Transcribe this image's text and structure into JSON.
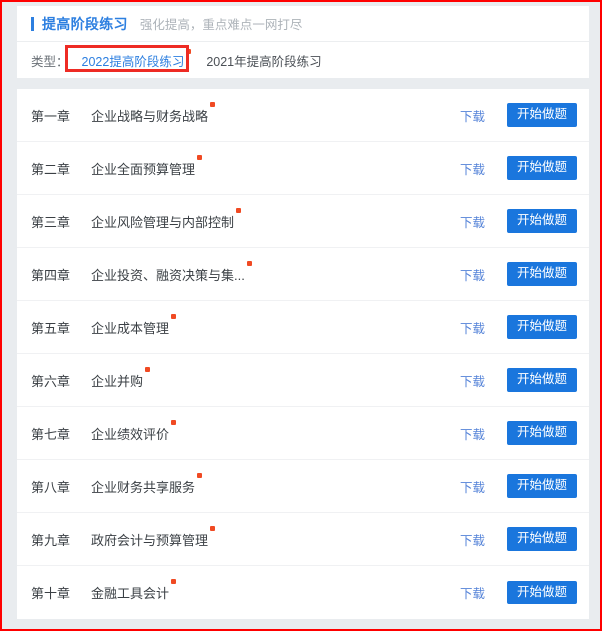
{
  "header": {
    "title": "提高阶段练习",
    "subtitle": "强化提高，重点难点一网打尽"
  },
  "filter": {
    "label": "类型：",
    "tabs": [
      {
        "label": "2022提高阶段练习",
        "active": true,
        "has_dot": true
      },
      {
        "label": "2021年提高阶段练习",
        "active": false,
        "has_dot": false
      }
    ]
  },
  "annotation": {
    "color": "#ee2b24",
    "target": "2022提高阶段练习"
  },
  "actions": {
    "download_label": "下载",
    "start_label": "开始做题"
  },
  "colors": {
    "brand_blue": "#2d7fe0",
    "button_blue": "#1a76dd",
    "link_blue": "#5583d8",
    "dot_orange": "#f04a23",
    "annotation_red": "#ee2b24",
    "page_bg": "#e9ecef",
    "card_bg": "#ffffff"
  },
  "chapters": [
    {
      "no": "第一章",
      "name": "企业战略与财务战略",
      "has_dot": true
    },
    {
      "no": "第二章",
      "name": "企业全面预算管理",
      "has_dot": true
    },
    {
      "no": "第三章",
      "name": "企业风险管理与内部控制",
      "has_dot": true
    },
    {
      "no": "第四章",
      "name": "企业投资、融资决策与集...",
      "has_dot": true
    },
    {
      "no": "第五章",
      "name": "企业成本管理",
      "has_dot": true
    },
    {
      "no": "第六章",
      "name": "企业并购",
      "has_dot": true
    },
    {
      "no": "第七章",
      "name": "企业绩效评价",
      "has_dot": true
    },
    {
      "no": "第八章",
      "name": "企业财务共享服务",
      "has_dot": true
    },
    {
      "no": "第九章",
      "name": "政府会计与预算管理",
      "has_dot": true
    },
    {
      "no": "第十章",
      "name": "金融工具会计",
      "has_dot": true
    }
  ]
}
